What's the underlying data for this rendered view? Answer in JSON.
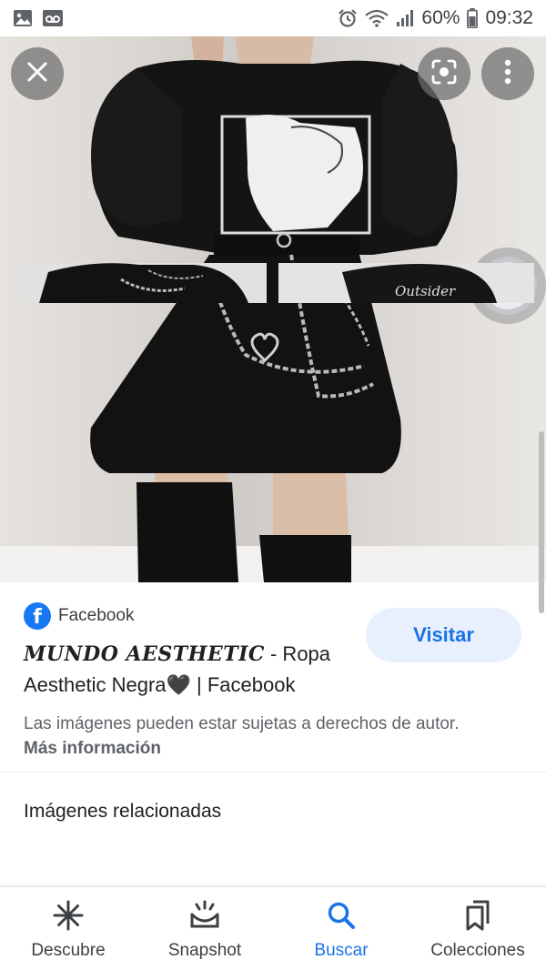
{
  "status_bar": {
    "battery": "60%",
    "time": "09:32",
    "icons": [
      "gallery-icon",
      "voicemail-icon",
      "alarm-icon",
      "wifi-icon",
      "signal-icon",
      "battery-icon"
    ]
  },
  "viewer": {
    "buttons": {
      "close": "close-icon",
      "lens": "lens-icon",
      "more": "more-vert-icon"
    }
  },
  "result": {
    "source": "Facebook",
    "title_styled": "𝑴𝑼𝑵𝑫𝑶 𝑨𝑬𝑺𝑻𝑯𝑬𝑻𝑰𝑪",
    "title_rest": " - Ropa Aesthetic Negra🖤 | Facebook",
    "visit_label": "Visitar",
    "notice": "Las imágenes pueden estar sujetas a derechos de autor.",
    "more_info": "Más información"
  },
  "related": {
    "title": "Imágenes relacionadas"
  },
  "bottom_nav": {
    "items": [
      {
        "label": "Descubre",
        "icon": "asterisk-icon"
      },
      {
        "label": "Snapshot",
        "icon": "snapshot-icon"
      },
      {
        "label": "Buscar",
        "icon": "search-icon"
      },
      {
        "label": "Colecciones",
        "icon": "collections-icon"
      }
    ],
    "active": "Buscar"
  },
  "colors": {
    "accent": "#1a73e8",
    "visit_bg": "#e8f0fe",
    "facebook": "#1877f2"
  }
}
